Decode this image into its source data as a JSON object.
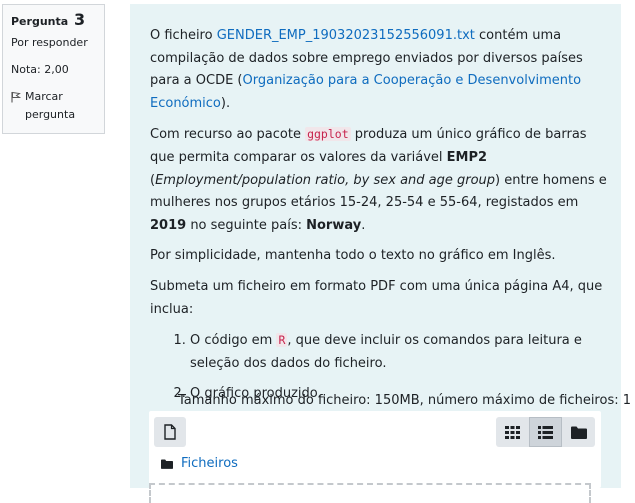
{
  "info": {
    "question_label": "Pergunta",
    "question_number": "3",
    "status": "Por responder",
    "grade": "Nota: 2,00",
    "flag_label": "Marcar pergunta"
  },
  "content": {
    "p1_pre": "O ficheiro ",
    "p1_file": "GENDER_EMP_19032023152556091.txt",
    "p1_mid": " contém uma compilação de dados sobre emprego enviados por diversos países para a OCDE (",
    "p1_org": "Organização para a Cooperação e Desenvolvimento Económico",
    "p1_post": ").",
    "p2_pre": "Com recurso ao pacote ",
    "p2_pkg": "ggplot",
    "p2_mid1": " produza um único gráfico de barras que permita comparar os valores da variável ",
    "p2_var": "EMP2",
    "p2_mid2": " (",
    "p2_var_desc": "Employment/population ratio, by sex and age group",
    "p2_mid3": ") entre homens e mulheres nos grupos etários 15-24, 25-54 e 55-64, registados em ",
    "p2_year": "2019",
    "p2_mid4": " no seguinte país: ",
    "p2_country": "Norway",
    "p2_post": ".",
    "p3": "Por simplicidade, mantenha todo o texto no gráfico em Inglês.",
    "p4": "Submeta um ficheiro em formato PDF com uma única página A4, que inclua:",
    "li1_pre": "O código em ",
    "li1_code": "R",
    "li1_post": ", que deve incluir os comandos para leitura e seleção dos dados do ficheiro.",
    "li2": "O gráfico produzido."
  },
  "limits": "Tamanho máximo do ficheiro: 150MB, número máximo de ficheiros: 1",
  "filemanager": {
    "path_label": "Ficheiros",
    "icons": {
      "add": "file-add-icon",
      "grid": "grid-view-icon",
      "list": "list-view-icon",
      "tree": "folder-view-icon",
      "path": "folder-icon"
    }
  },
  "colors": {
    "link": "#0f6cbf",
    "panel_bg": "#e7f3f5",
    "code": "#c7254e"
  }
}
